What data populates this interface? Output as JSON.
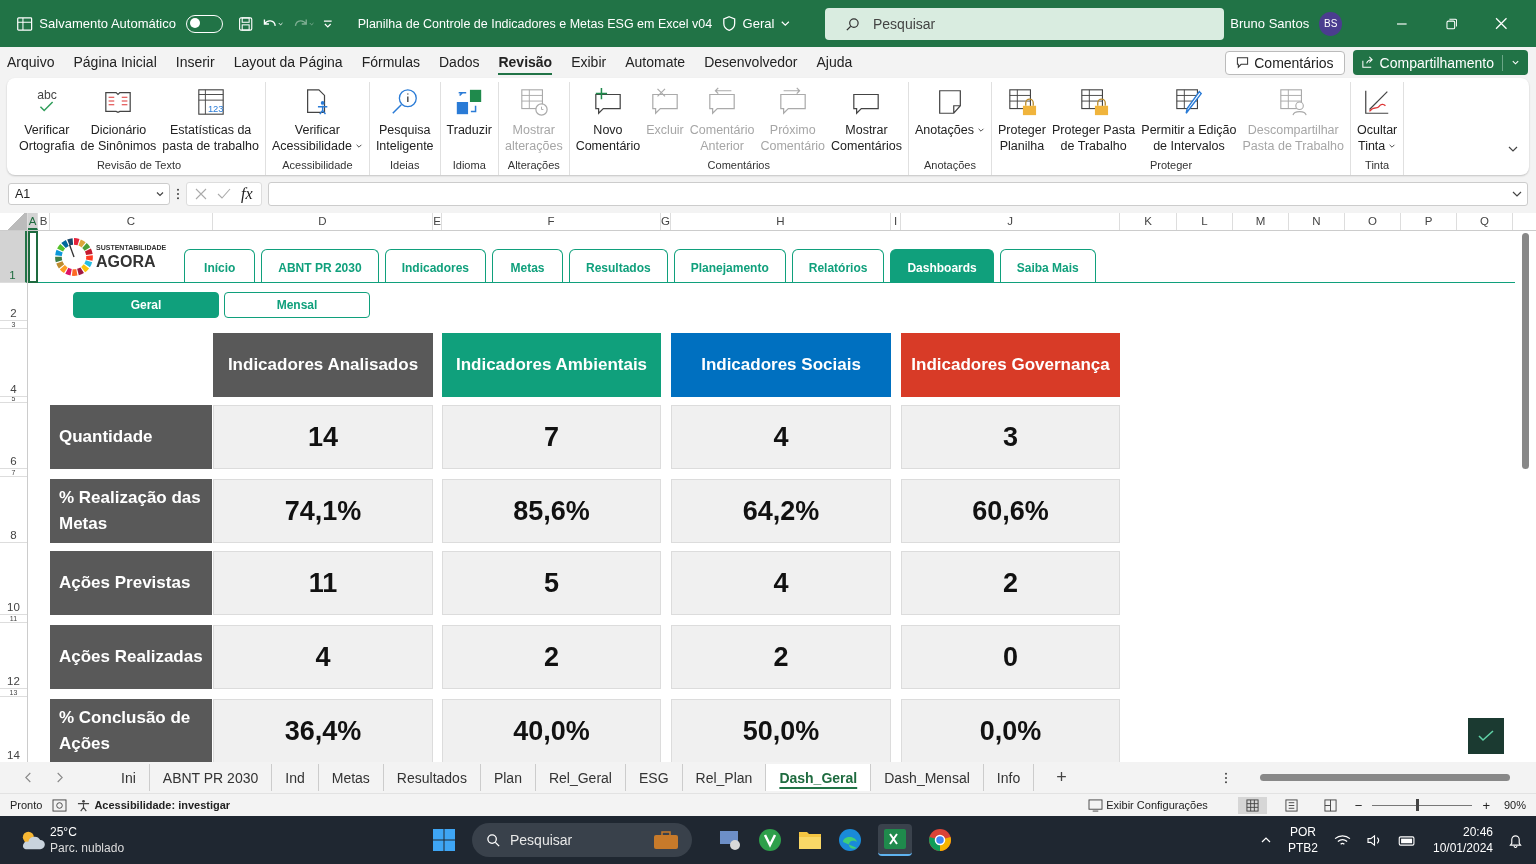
{
  "title_bar": {
    "autosave_label": "Salvamento Automático",
    "autosave_on": false,
    "document_title": "Planilha de Controle de Indicadores e Metas ESG em Excel v04",
    "sensitivity": "Geral",
    "search_placeholder": "Pesquisar",
    "user_name": "Bruno Santos",
    "user_initials": "BS"
  },
  "menu": {
    "tabs": [
      {
        "label": "Arquivo",
        "selected": false
      },
      {
        "label": "Página Inicial",
        "selected": false
      },
      {
        "label": "Inserir",
        "selected": false
      },
      {
        "label": "Layout da Página",
        "selected": false
      },
      {
        "label": "Fórmulas",
        "selected": false
      },
      {
        "label": "Dados",
        "selected": false
      },
      {
        "label": "Revisão",
        "selected": true
      },
      {
        "label": "Exibir",
        "selected": false
      },
      {
        "label": "Automate",
        "selected": false
      },
      {
        "label": "Desenvolvedor",
        "selected": false
      },
      {
        "label": "Ajuda",
        "selected": false
      }
    ],
    "comments_button": "Comentários",
    "share_button": "Compartilhamento"
  },
  "ribbon": {
    "groups": [
      {
        "label": "Revisão de Texto",
        "buttons": [
          {
            "label": "Verificar\nOrtografia",
            "glyph": "abc",
            "disabled": false,
            "has_menu": false
          },
          {
            "label": "Dicionário\nde Sinônimos",
            "disabled": false,
            "has_menu": false
          },
          {
            "label": "Estatísticas da\npasta de trabalho",
            "glyph": "123",
            "disabled": false,
            "has_menu": false
          }
        ]
      },
      {
        "label": "Acessibilidade",
        "buttons": [
          {
            "label": "Verificar\nAcessibilidade",
            "disabled": false,
            "has_menu": true
          }
        ]
      },
      {
        "label": "Ideias",
        "buttons": [
          {
            "label": "Pesquisa\nInteligente",
            "disabled": false,
            "has_menu": false
          }
        ]
      },
      {
        "label": "Idioma",
        "buttons": [
          {
            "label": "Traduzir",
            "disabled": false,
            "has_menu": false
          }
        ]
      },
      {
        "label": "Alterações",
        "buttons": [
          {
            "label": "Mostrar\nalterações",
            "disabled": true,
            "has_menu": false
          }
        ]
      },
      {
        "label": "Comentários",
        "buttons": [
          {
            "label": "Novo\nComentário",
            "disabled": false,
            "has_menu": false
          },
          {
            "label": "Excluir",
            "disabled": true,
            "has_menu": false
          },
          {
            "label": "Comentário\nAnterior",
            "disabled": true,
            "has_menu": false
          },
          {
            "label": "Próximo\nComentário",
            "disabled": true,
            "has_menu": false
          },
          {
            "label": "Mostrar\nComentários",
            "disabled": false,
            "has_menu": false
          }
        ]
      },
      {
        "label": "Anotações",
        "buttons": [
          {
            "label": "Anotações",
            "disabled": false,
            "has_menu": true
          }
        ]
      },
      {
        "label": "Proteger",
        "buttons": [
          {
            "label": "Proteger\nPlanilha",
            "disabled": false,
            "has_menu": false
          },
          {
            "label": "Proteger Pasta\nde Trabalho",
            "disabled": false,
            "has_menu": false
          },
          {
            "label": "Permitir a Edição\nde Intervalos",
            "disabled": false,
            "has_menu": false
          },
          {
            "label": "Descompartilhar\nPasta de Trabalho",
            "disabled": true,
            "has_menu": false
          }
        ]
      },
      {
        "label": "Tinta",
        "buttons": [
          {
            "label": "Ocultar\nTinta",
            "disabled": false,
            "has_menu": true
          }
        ]
      }
    ]
  },
  "formula_bar": {
    "name_box": "A1",
    "function_label": "fx"
  },
  "columns": [
    {
      "label": "A",
      "selected": true
    },
    {
      "label": "B",
      "selected": false
    },
    {
      "label": "C",
      "selected": false
    },
    {
      "label": "D",
      "selected": false
    },
    {
      "label": "E",
      "selected": false
    },
    {
      "label": "F",
      "selected": false
    },
    {
      "label": "G",
      "selected": false
    },
    {
      "label": "H",
      "selected": false
    },
    {
      "label": "I",
      "selected": false
    },
    {
      "label": "J",
      "selected": false
    },
    {
      "label": "K",
      "selected": false
    },
    {
      "label": "L",
      "selected": false
    },
    {
      "label": "M",
      "selected": false
    },
    {
      "label": "N",
      "selected": false
    },
    {
      "label": "O",
      "selected": false
    },
    {
      "label": "P",
      "selected": false
    },
    {
      "label": "Q",
      "selected": false
    }
  ],
  "rows": [
    {
      "label": "1",
      "selected": true
    },
    {
      "label": "2",
      "selected": false
    },
    {
      "label": "3",
      "selected": false
    },
    {
      "label": "4",
      "selected": false
    },
    {
      "label": "5",
      "selected": false
    },
    {
      "label": "6",
      "selected": false
    },
    {
      "label": "7",
      "selected": false
    },
    {
      "label": "8",
      "selected": false
    },
    {
      "label": "10",
      "selected": false
    },
    {
      "label": "11",
      "selected": false
    },
    {
      "label": "12",
      "selected": false
    },
    {
      "label": "13",
      "selected": false
    },
    {
      "label": "14",
      "selected": false
    }
  ],
  "logo": {
    "tagline": "SUSTENTABILIDADE",
    "wordmark": "AGORA"
  },
  "nav_tabs": [
    {
      "label": "Início",
      "selected": false
    },
    {
      "label": "ABNT PR 2030",
      "selected": false
    },
    {
      "label": "Indicadores",
      "selected": false
    },
    {
      "label": "Metas",
      "selected": false
    },
    {
      "label": "Resultados",
      "selected": false
    },
    {
      "label": "Planejamento",
      "selected": false
    },
    {
      "label": "Relatórios",
      "selected": false
    },
    {
      "label": "Dashboards",
      "selected": true
    },
    {
      "label": "Saiba Mais",
      "selected": false
    }
  ],
  "view_tabs": [
    {
      "label": "Geral",
      "selected": true
    },
    {
      "label": "Mensal",
      "selected": false
    }
  ],
  "dashboard": {
    "headers": [
      {
        "label": "Indicadores Analisados",
        "color": "#595959"
      },
      {
        "label": "Indicadores Ambientais",
        "color": "#10a07c"
      },
      {
        "label": "Indicadores Sociais",
        "color": "#0070c0"
      },
      {
        "label": "Indicadores Governança",
        "color": "#d83b27"
      }
    ],
    "rows": [
      {
        "label": "Quantidade",
        "values": [
          "14",
          "7",
          "4",
          "3"
        ]
      },
      {
        "label": "%  Realização das Metas",
        "values": [
          "74,1%",
          "85,6%",
          "64,2%",
          "60,6%"
        ]
      },
      {
        "label": "Ações Previstas",
        "values": [
          "11",
          "5",
          "4",
          "2"
        ]
      },
      {
        "label": "Ações Realizadas",
        "values": [
          "4",
          "2",
          "2",
          "0"
        ]
      },
      {
        "label": "% Conclusão de Ações",
        "values": [
          "36,4%",
          "40,0%",
          "50,0%",
          "0,0%"
        ]
      }
    ]
  },
  "sheet_tabs": [
    {
      "label": "Ini",
      "selected": false
    },
    {
      "label": "ABNT PR 2030",
      "selected": false
    },
    {
      "label": "Ind",
      "selected": false
    },
    {
      "label": "Metas",
      "selected": false
    },
    {
      "label": "Resultados",
      "selected": false
    },
    {
      "label": "Plan",
      "selected": false
    },
    {
      "label": "Rel_Geral",
      "selected": false
    },
    {
      "label": "ESG",
      "selected": false
    },
    {
      "label": "Rel_Plan",
      "selected": false
    },
    {
      "label": "Dash_Geral",
      "selected": true
    },
    {
      "label": "Dash_Mensal",
      "selected": false
    },
    {
      "label": "Info",
      "selected": false
    }
  ],
  "add_sheet": "+",
  "status_bar": {
    "status": "Pronto",
    "accessibility": "Acessibilidade: investigar",
    "display_settings": "Exibir Configurações",
    "views": [
      {
        "selected": true
      },
      {
        "selected": false
      },
      {
        "selected": false
      }
    ],
    "zoom_out": "−",
    "zoom_in": "+",
    "zoom": {
      "level": 0.45,
      "label": "90%"
    }
  },
  "taskbar": {
    "temperature": "25°C",
    "weather": "Parc. nublado",
    "search_placeholder": "Pesquisar",
    "language": "POR",
    "layout": "PTB2",
    "time": "20:46",
    "date": "10/01/2024"
  }
}
